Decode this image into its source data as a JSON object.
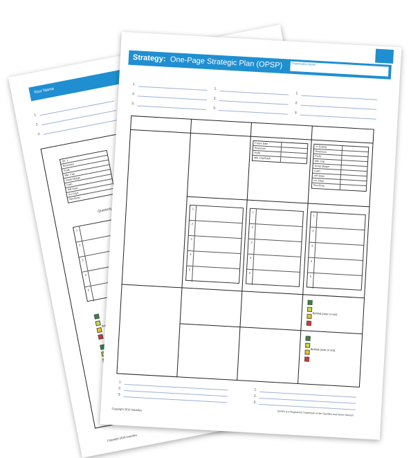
{
  "back_sheet": {
    "header_title": "Your Name",
    "line_numbers": [
      "1.",
      "2.",
      "3."
    ],
    "table_rows": [
      "Qtr. 1",
      "Revenues",
      "Profit",
      "Mkt. Cap",
      "Gross Margin",
      "Cash",
      "A/R Days",
      "Inv. Days",
      "Rev./Emp."
    ],
    "section_label": "Quarterly Pri",
    "list_numbers": [
      "1",
      "2",
      "3",
      "4",
      "5"
    ],
    "legend_text": "Behind (or not yet",
    "copyright": "Copyright 2016 Gazelles"
  },
  "front_sheet": {
    "title_bold": "Strategy:",
    "title_rest": "One-Page Strategic Plan (OPSP)",
    "org_label": "Organization Name",
    "top_numbers": [
      "1.",
      "2.",
      "3."
    ],
    "table_a_rows": [
      "Future Date",
      "Revenues",
      "Profit",
      "Mkt. Cap/Cash"
    ],
    "table_b_rows": [
      "Yr Ending",
      "Revenues",
      "Profit",
      "Mkt. Cap",
      "Gross Margin",
      "Cash",
      "A/R Days",
      "Inv. Days",
      "Rev./Emp."
    ],
    "list_numbers": [
      "1",
      "2",
      "3",
      "4",
      "5"
    ],
    "legend_text": "Behind (over or not)",
    "bottom_numbers": [
      "1.",
      "2.",
      "3."
    ],
    "copyright": "Copyright 2016 Gazelles",
    "trademark": "(Gr/IG) is a Registered Trademark of the Gazelles and Verne Harnish"
  },
  "colors": {
    "header_blue": "#1f8fd1",
    "line_blue": "#9bb0d6",
    "legend": [
      "#2e8b2e",
      "#c8d94a",
      "#f0c419",
      "#e03030"
    ]
  }
}
